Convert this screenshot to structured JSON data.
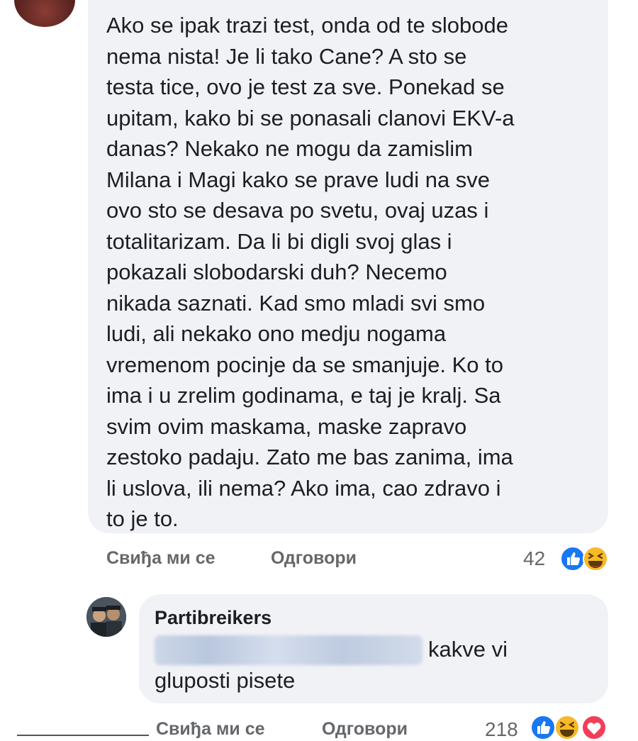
{
  "post_comment": {
    "lines": [
      "Ako se ipak trazi test, onda od te slobode",
      "nema nista! Je li tako Cane? A sto se",
      "testa tice, ovo je test za sve. Ponekad se",
      "upitam, kako bi se ponasali clanovi EKV-a",
      "danas? Nekako ne mogu da zamislim",
      "Milana i Magi kako se prave ludi na sve",
      "ovo sto se desava po svetu, ovaj uzas i",
      "totalitarizam. Da li bi digli svoj glas i",
      "pokazali slobodarski duh? Necemo",
      "nikada saznati. Kad smo mladi svi smo",
      "ludi, ali nekako ono medju nogama",
      "vremenom pocinje da se smanjuje. Ko to",
      "ima i u zrelim godinama, e taj je kralj. Sa",
      "svim ovim maskama, maske zapravo",
      "zestoko padaju. Zato me bas zanima, ima",
      "li uslova, ili nema? Ako ima, cao zdravo i",
      "to je to."
    ],
    "like_label": "Свиђа ми се",
    "reply_label": "Одговори",
    "reaction_count": "42",
    "reaction_icons": [
      "like-icon",
      "haha-icon"
    ]
  },
  "reply_comment": {
    "author": "Partibreikers",
    "line1": "kakve vi",
    "line2": "gluposti pisete",
    "like_label": "Свиђа ми се",
    "reply_label": "Одговори",
    "reaction_count": "218",
    "reaction_icons": [
      "like-icon",
      "haha-icon",
      "love-icon"
    ]
  },
  "colors": {
    "bubble_bg": "#f0f2f5",
    "like_blue": "#1877f2",
    "haha_yellow": "#f7b928",
    "love_red": "#f33e58",
    "meta_gray": "#65676b"
  }
}
